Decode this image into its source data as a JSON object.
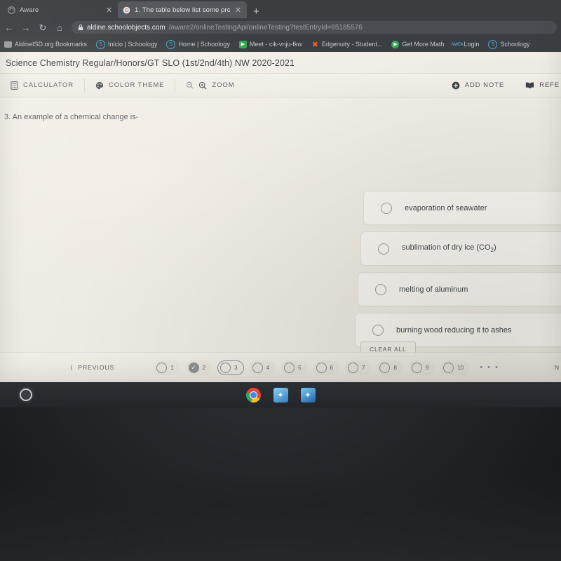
{
  "browser": {
    "tabs": [
      {
        "title": "Aware",
        "active": false,
        "favicon": "aware-icon"
      },
      {
        "title": "1. The table below list some pro",
        "active": true,
        "favicon": "google-icon"
      }
    ],
    "new_tab_label": "+",
    "close_label": "✕",
    "nav": {
      "back_icon": "back-arrow-icon",
      "forward_icon": "forward-arrow-icon",
      "reload_icon": "reload-icon",
      "home_icon": "home-icon",
      "lock_icon": "lock-icon"
    },
    "address": {
      "host": "aldine.schoolobjects.com",
      "path": "/aware2/onlineTestingApi/onlineTesting?testEntryId=65185576"
    },
    "bookmarks": [
      {
        "label": "AldineISD.org Bookmarks",
        "icon": "folder-icon",
        "color": "#9aa0a6"
      },
      {
        "label": "Inicio | Schoology",
        "icon": "schoology-icon",
        "color": "#4aa6c9"
      },
      {
        "label": "Home | Schoology",
        "icon": "schoology-icon",
        "color": "#4aa6c9"
      },
      {
        "label": "Meet - cik-vnju-fkw",
        "icon": "google-meet-icon",
        "color": "#34a853"
      },
      {
        "label": "Edgenuity - Student...",
        "icon": "edgenuity-icon",
        "color": "#e8662a"
      },
      {
        "label": "Get More Math",
        "icon": "get-more-math-icon",
        "color": "#34a853"
      },
      {
        "label": "Login",
        "icon": "nwea-icon",
        "color": "#5aa9cf"
      },
      {
        "label": "Schoology",
        "icon": "schoology-icon",
        "color": "#4aa6c9"
      }
    ]
  },
  "test": {
    "title": "Science Chemistry Regular/Honors/GT SLO (1st/2nd/4th) NW 2020-2021",
    "toolbar": {
      "calculator": "CALCULATOR",
      "color_theme": "COLOR THEME",
      "zoom": "ZOOM",
      "zoom_out_icon": "zoom-out-icon",
      "zoom_in_icon": "zoom-in-icon",
      "calculator_icon": "calculator-icon",
      "palette_icon": "palette-icon",
      "add_note": "ADD NOTE",
      "add_note_icon": "plus-circle-icon",
      "reference": "REFE",
      "reference_icon": "book-icon"
    },
    "question": {
      "number": "3.",
      "text": "3. An example of a chemical change is-",
      "options": [
        {
          "label": "evaporation of seawater",
          "selected": false
        },
        {
          "label_pre": "sublimation of dry ice (CO",
          "label_sub": "2",
          "label_post": ")",
          "selected": false
        },
        {
          "label": "melting of aluminum",
          "selected": false
        },
        {
          "label": "burning wood reducing it to ashes",
          "selected": false
        }
      ],
      "clear_all": "CLEAR ALL"
    },
    "navigation": {
      "previous": "PREVIOUS",
      "previous_icon": "chevron-left-icon",
      "next": "N",
      "ellipsis": "• • •",
      "items": [
        {
          "number": "1",
          "state": "unanswered"
        },
        {
          "number": "2",
          "state": "answered"
        },
        {
          "number": "3",
          "state": "current"
        },
        {
          "number": "4",
          "state": "unanswered"
        },
        {
          "number": "5",
          "state": "unanswered"
        },
        {
          "number": "6",
          "state": "unanswered"
        },
        {
          "number": "7",
          "state": "unanswered"
        },
        {
          "number": "8",
          "state": "unanswered"
        },
        {
          "number": "9",
          "state": "unanswered"
        },
        {
          "number": "10",
          "state": "unanswered"
        }
      ],
      "check_glyph": "✓"
    }
  },
  "shelf": {
    "launcher": "launcher-button",
    "apps": [
      {
        "name": "chrome-icon",
        "label": ""
      },
      {
        "name": "app-icon-blue-1",
        "label": "✦"
      },
      {
        "name": "app-icon-blue-2",
        "label": "✦"
      }
    ]
  }
}
